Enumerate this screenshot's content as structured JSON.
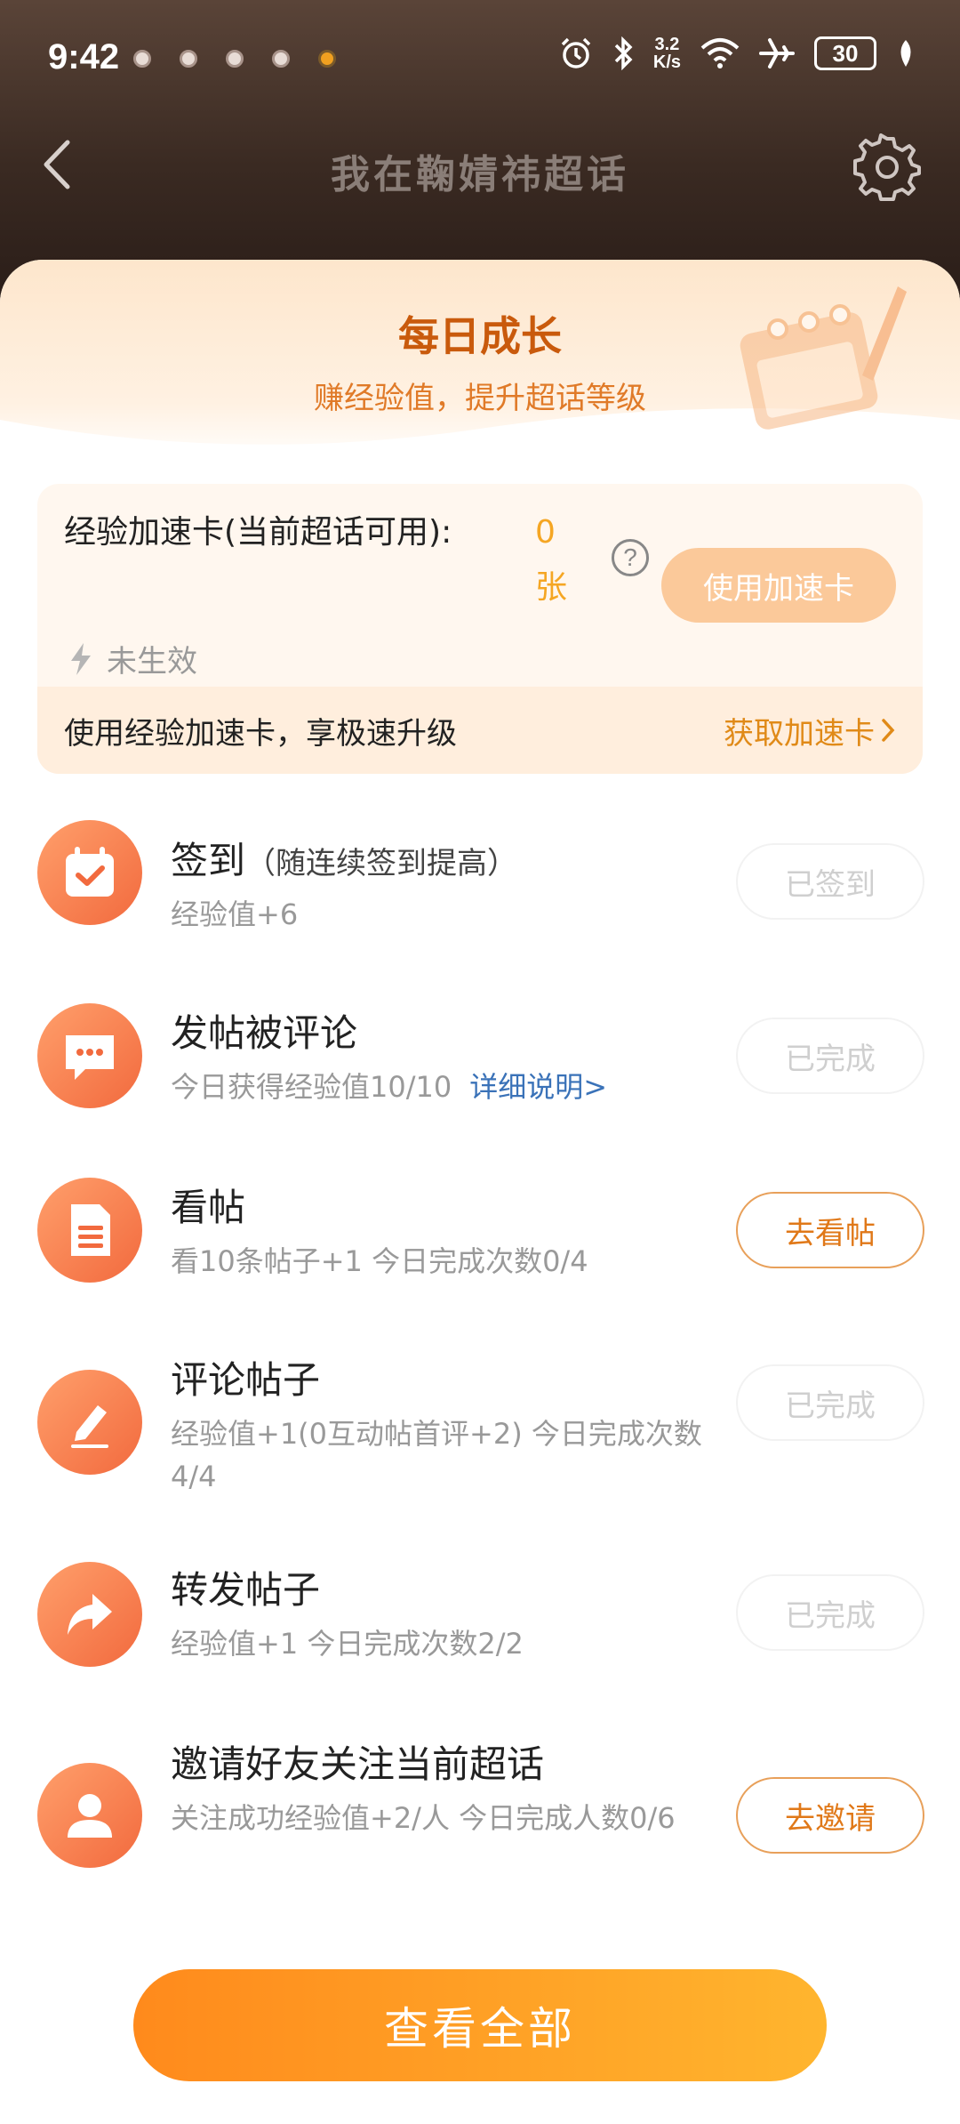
{
  "status_bar": {
    "time": "9:42",
    "net_speed_value": "3.2",
    "net_speed_unit": "K/s",
    "battery": "30",
    "icons": [
      "alarm-icon",
      "bluetooth-icon",
      "wifi-icon",
      "airplane-icon",
      "leaf-icon"
    ]
  },
  "nav": {
    "title": "我在鞠婧祎超话"
  },
  "hero": {
    "title": "每日成长",
    "subtitle": "赚经验值，提升超话等级"
  },
  "accel_card": {
    "title": "经验加速卡(当前超话可用):",
    "count_value": "0",
    "count_unit": "张",
    "help": "?",
    "use_button": "使用加速卡",
    "status": "未生效",
    "footer_text": "使用经验加速卡，享极速升级",
    "get_link": "获取加速卡"
  },
  "tasks": [
    {
      "title": "签到",
      "note": "（随连续签到提高）",
      "desc": "经验值+6",
      "button": "已签到",
      "state": "done",
      "icon": "calendar-check-icon"
    },
    {
      "title": "发帖被评论",
      "desc": "今日获得经验值10/10",
      "link": "详细说明>",
      "button": "已完成",
      "state": "done",
      "icon": "chat-bubble-icon"
    },
    {
      "title": "看帖",
      "desc": "看10条帖子+1   今日完成次数0/4",
      "button": "去看帖",
      "state": "go",
      "icon": "document-icon"
    },
    {
      "title": "评论帖子",
      "desc": "经验值+1(0互动帖首评+2)   今日完成次数4/4",
      "button": "已完成",
      "state": "done",
      "icon": "pencil-icon"
    },
    {
      "title": "转发帖子",
      "desc": "经验值+1   今日完成次数2/2",
      "button": "已完成",
      "state": "done",
      "icon": "share-arrow-icon"
    },
    {
      "title": "邀请好友关注当前超话",
      "desc": "关注成功经验值+2/人   今日完成人数0/6",
      "button": "去邀请",
      "state": "go",
      "icon": "user-icon"
    }
  ],
  "view_all_button": "查看全部",
  "colors": {
    "accent": "#f5a623",
    "link": "#3a72b8",
    "icon_gradient_start": "#ff9f6b",
    "icon_gradient_end": "#f26a3e"
  }
}
